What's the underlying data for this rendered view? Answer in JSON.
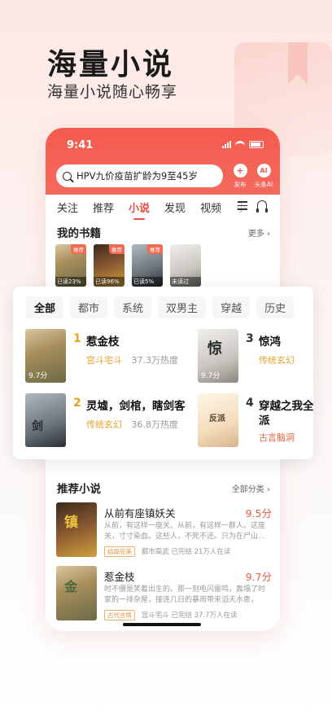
{
  "hero": {
    "title": "海量小说",
    "subtitle": "海量小说随心畅享"
  },
  "status": {
    "time": "9:41"
  },
  "search": {
    "query": "HPV九价疫苗扩龄为9至45岁"
  },
  "top_actions": [
    {
      "icon": "plus-icon",
      "glyph": "+",
      "label": "发布"
    },
    {
      "icon": "ai-icon",
      "glyph": "AI",
      "label": "头条AI"
    }
  ],
  "tabs": [
    "关注",
    "推荐",
    "小说",
    "发现",
    "视频",
    "小"
  ],
  "active_tab": "小说",
  "my_books": {
    "title": "我的书籍",
    "more": "更多 ›",
    "items": [
      {
        "badge": "推荐",
        "progress": "已读23%"
      },
      {
        "badge": "推荐",
        "progress": "已读96%"
      },
      {
        "badge": "推荐",
        "progress": "已读5%"
      },
      {
        "badge": "",
        "progress": "未读过"
      }
    ]
  },
  "categories": [
    "全部",
    "都市",
    "系统",
    "双男主",
    "穿越",
    "历史"
  ],
  "active_category": "全部",
  "ranking": [
    {
      "rank": "1",
      "title": "惹金枝",
      "genre": "宫斗宅斗",
      "heat": "37.3万热度",
      "score": "9.7分"
    },
    {
      "rank": "2",
      "title": "灵墟，剑棺，瞎剑客",
      "genre": "传统玄幻",
      "heat": "36.8万热度",
      "score": ""
    },
    {
      "rank": "3",
      "title": "惊鸿",
      "genre": "传统玄幻",
      "heat": "",
      "score": "9.7分"
    },
    {
      "rank": "4",
      "title": "穿越之我全",
      "title2": "派",
      "genre": "古言脑洞",
      "heat": "",
      "score": ""
    }
  ],
  "recommend": {
    "title": "推荐小说",
    "more": "全部分类 ›",
    "items": [
      {
        "title": "从前有座镇妖关",
        "score": "9.5分",
        "desc": "从前，有这样一座关。从前，有这样一群人。这座关，寸寸染血。这些人，不死不还。只为在尸山...",
        "tag": "结局完美",
        "meta": "都市高武  已完结  21万人在读"
      },
      {
        "title": "惹金枝",
        "score": "9.7分",
        "desc": "时不儇是笑着出生的。那一刻电闪雷鸣，轰塌了时家的一排杂屋，接连几日的暴雨带来滔天水患，受...",
        "tag": "古代言情",
        "meta": "宫斗宅斗  已完结  37.7万人在读"
      }
    ]
  }
}
